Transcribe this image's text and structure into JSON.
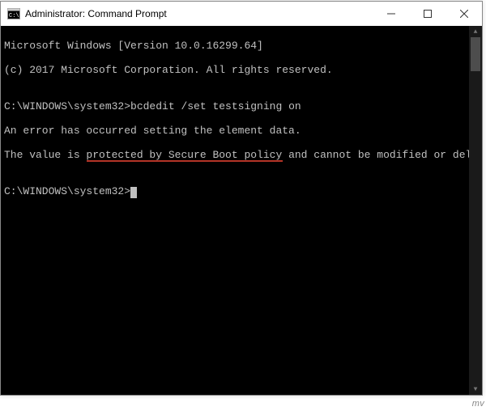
{
  "window": {
    "title": "Administrator: Command Prompt"
  },
  "terminal": {
    "line1": "Microsoft Windows [Version 10.0.16299.64]",
    "line2": "(c) 2017 Microsoft Corporation. All rights reserved.",
    "blank1": "",
    "prompt1_path": "C:\\WINDOWS\\system32>",
    "prompt1_cmd": "bcdedit /set testsigning on",
    "err1": "An error has occurred setting the element data.",
    "err2_pre": "The value is ",
    "err2_hl": "protected by Secure Boot policy",
    "err2_post": " and cannot be modified or deleted.",
    "blank2": "",
    "prompt2_path": "C:\\WINDOWS\\system32>"
  },
  "watermark": "mv"
}
